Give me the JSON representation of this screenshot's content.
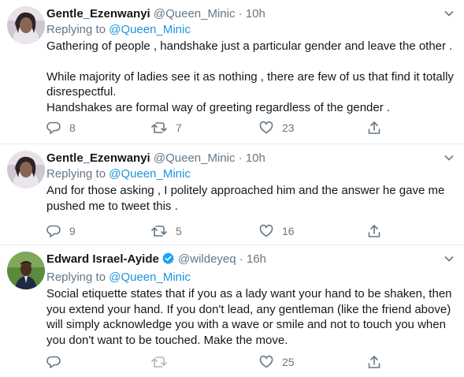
{
  "tweets": [
    {
      "name": "Gentle_Ezenwanyi",
      "handle": "@Queen_Minic",
      "dot": "·",
      "time": "10h",
      "replying_prefix": "Replying to",
      "replying_to": "@Queen_Minic",
      "paragraphs": [
        "Gathering of people , handshake just a particular gender and leave the other .",
        "While majority of ladies see it as nothing , there are few of us that find it totally disrespectful.",
        "Handshakes are formal way of greeting regardless of the gender ."
      ],
      "replies": "8",
      "retweets": "7",
      "likes": "23",
      "verified": false
    },
    {
      "name": "Gentle_Ezenwanyi",
      "handle": "@Queen_Minic",
      "dot": "·",
      "time": "10h",
      "replying_prefix": "Replying to",
      "replying_to": "@Queen_Minic",
      "paragraphs": [
        "And for those asking , I politely approached him and the answer he gave me pushed me to tweet this ."
      ],
      "replies": "9",
      "retweets": "5",
      "likes": "16",
      "verified": false
    },
    {
      "name": "Edward Israel-Ayide",
      "handle": "@wildeyeq",
      "dot": "·",
      "time": "16h",
      "replying_prefix": "Replying to",
      "replying_to": "@Queen_Minic",
      "paragraphs": [
        "Social etiquette states that if you as a lady want your hand to be shaken, then you extend your hand. If you don't lead, any gentleman (like the friend above) will simply acknowledge you with a wave or smile and not to touch you when you don't want to be touched. Make the move."
      ],
      "replies": "",
      "retweets": "",
      "likes": "25",
      "verified": true
    }
  ],
  "colors": {
    "accent": "#1b95e0",
    "muted": "#657786",
    "text": "#14171a",
    "verified": "#1da1f2"
  },
  "icons": [
    "reply-icon",
    "retweet-icon",
    "like-icon",
    "share-icon",
    "chevron-down-icon",
    "verified-badge-icon"
  ]
}
